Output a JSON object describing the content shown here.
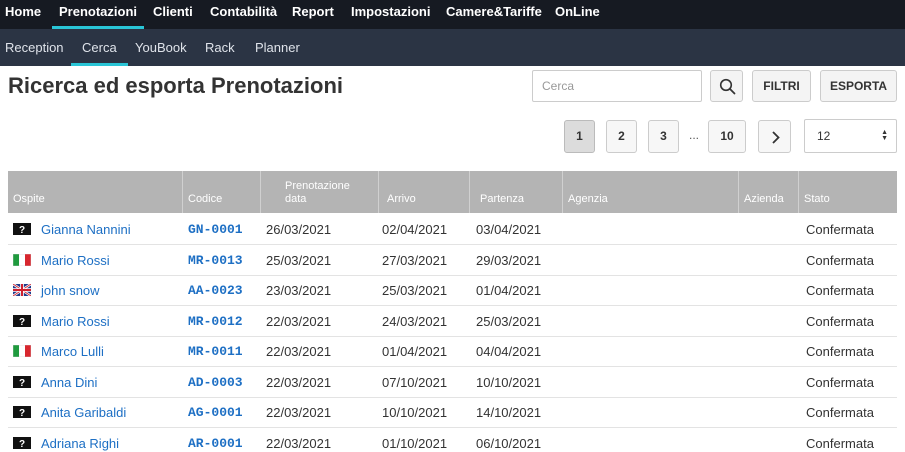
{
  "topnav": {
    "items": [
      {
        "label": "Home"
      },
      {
        "label": "Prenotazioni"
      },
      {
        "label": "Clienti"
      },
      {
        "label": "Contabilità"
      },
      {
        "label": "Report"
      },
      {
        "label": "Impostazioni"
      },
      {
        "label": "Camere&Tariffe"
      },
      {
        "label": "OnLine"
      }
    ],
    "active": "Prenotazioni"
  },
  "subnav": {
    "items": [
      {
        "label": "Reception"
      },
      {
        "label": "Cerca"
      },
      {
        "label": "YouBook"
      },
      {
        "label": "Rack"
      },
      {
        "label": "Planner"
      }
    ],
    "active": "Cerca"
  },
  "page": {
    "title": "Ricerca ed esporta Prenotazioni"
  },
  "toolbar": {
    "search_placeholder": "Cerca",
    "search_value": "",
    "search_icon": "search-icon",
    "filtri_label": "FILTRI",
    "esporta_label": "ESPORTA"
  },
  "pagination": {
    "pages": [
      "1",
      "2",
      "3",
      "10"
    ],
    "current": "1",
    "ellipsis": "...",
    "next_icon": "chevron-right-icon",
    "per_page": "12"
  },
  "table": {
    "columns": [
      {
        "label": "Ospite"
      },
      {
        "label": "Codice"
      },
      {
        "label": "Prenotazione data"
      },
      {
        "label": "Arrivo"
      },
      {
        "label": "Partenza"
      },
      {
        "label": "Agenzia"
      },
      {
        "label": "Azienda"
      },
      {
        "label": "Stato"
      }
    ],
    "rows": [
      {
        "flag": "unknown",
        "guest": "Gianna Nannini",
        "code": "GN-0001",
        "booking_date": "26/03/2021",
        "arrival": "02/04/2021",
        "departure": "03/04/2021",
        "agency": "",
        "company": "",
        "status": "Confermata"
      },
      {
        "flag": "italy",
        "guest": "Mario Rossi",
        "code": "MR-0013",
        "booking_date": "25/03/2021",
        "arrival": "27/03/2021",
        "departure": "29/03/2021",
        "agency": "",
        "company": "",
        "status": "Confermata"
      },
      {
        "flag": "uk",
        "guest": "john snow",
        "code": "AA-0023",
        "booking_date": "23/03/2021",
        "arrival": "25/03/2021",
        "departure": "01/04/2021",
        "agency": "",
        "company": "",
        "status": "Confermata"
      },
      {
        "flag": "unknown",
        "guest": "Mario Rossi",
        "code": "MR-0012",
        "booking_date": "22/03/2021",
        "arrival": "24/03/2021",
        "departure": "25/03/2021",
        "agency": "",
        "company": "",
        "status": "Confermata"
      },
      {
        "flag": "italy",
        "guest": "Marco Lulli",
        "code": "MR-0011",
        "booking_date": "22/03/2021",
        "arrival": "01/04/2021",
        "departure": "04/04/2021",
        "agency": "",
        "company": "",
        "status": "Confermata"
      },
      {
        "flag": "unknown",
        "guest": "Anna Dini",
        "code": "AD-0003",
        "booking_date": "22/03/2021",
        "arrival": "07/10/2021",
        "departure": "10/10/2021",
        "agency": "",
        "company": "",
        "status": "Confermata"
      },
      {
        "flag": "unknown",
        "guest": "Anita Garibaldi",
        "code": "AG-0001",
        "booking_date": "22/03/2021",
        "arrival": "10/10/2021",
        "departure": "14/10/2021",
        "agency": "",
        "company": "",
        "status": "Confermata"
      },
      {
        "flag": "unknown",
        "guest": "Adriana Righi",
        "code": "AR-0001",
        "booking_date": "22/03/2021",
        "arrival": "01/10/2021",
        "departure": "06/10/2021",
        "agency": "",
        "company": "",
        "status": "Confermata"
      }
    ]
  },
  "colors": {
    "topnav_bg": "#161a22",
    "subnav_bg": "#2b3444",
    "accent": "#29c5d6",
    "link": "#1d6fc4",
    "table_header_bg": "#b4b4b4"
  }
}
